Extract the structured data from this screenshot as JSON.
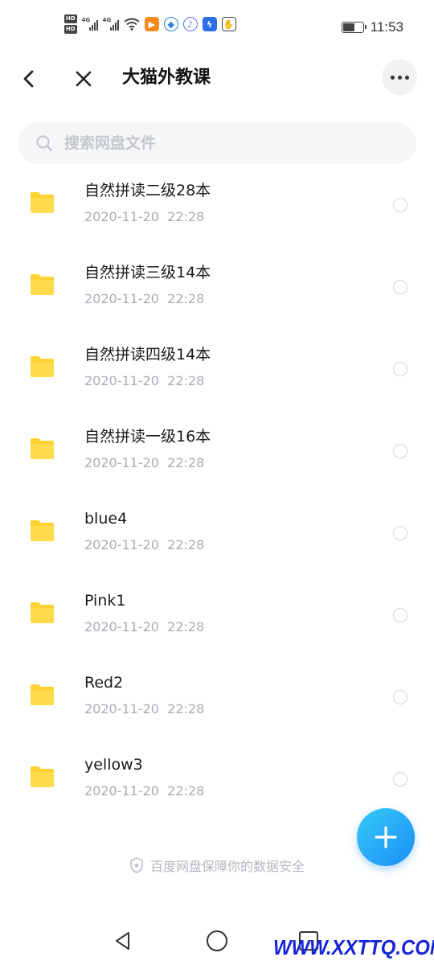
{
  "status_bar": {
    "hd1": "HD",
    "hd2": "HD",
    "net1": "4G",
    "net2": "4G",
    "time": "11:53",
    "battery_level": 0.6
  },
  "header": {
    "title": "大猫外教课"
  },
  "search": {
    "placeholder": "搜索网盘文件"
  },
  "files": [
    {
      "name": "自然拼读二级28本",
      "date": "2020-11-20  22:28"
    },
    {
      "name": "自然拼读三级14本",
      "date": "2020-11-20  22:28"
    },
    {
      "name": "自然拼读四级14本",
      "date": "2020-11-20  22:28"
    },
    {
      "name": "自然拼读一级16本",
      "date": "2020-11-20  22:28"
    },
    {
      "name": "blue4",
      "date": "2020-11-20  22:28"
    },
    {
      "name": "Pink1",
      "date": "2020-11-20  22:28"
    },
    {
      "name": "Red2",
      "date": "2020-11-20  22:28"
    },
    {
      "name": "yellow3",
      "date": "2020-11-20  22:28"
    }
  ],
  "footer": {
    "security_note": "百度网盘保障你的数据安全"
  },
  "watermark": "WWW.XXTTQ.COM",
  "colors": {
    "folder": "#ffd233",
    "fab": "#1a8ff7",
    "watermark": "#1524d8"
  },
  "icons": {
    "back": "chevron-left-icon",
    "close": "close-icon",
    "more": "more-horizontal-icon",
    "search": "search-icon",
    "folder": "folder-icon",
    "add": "plus-icon",
    "shield": "shield-icon"
  }
}
